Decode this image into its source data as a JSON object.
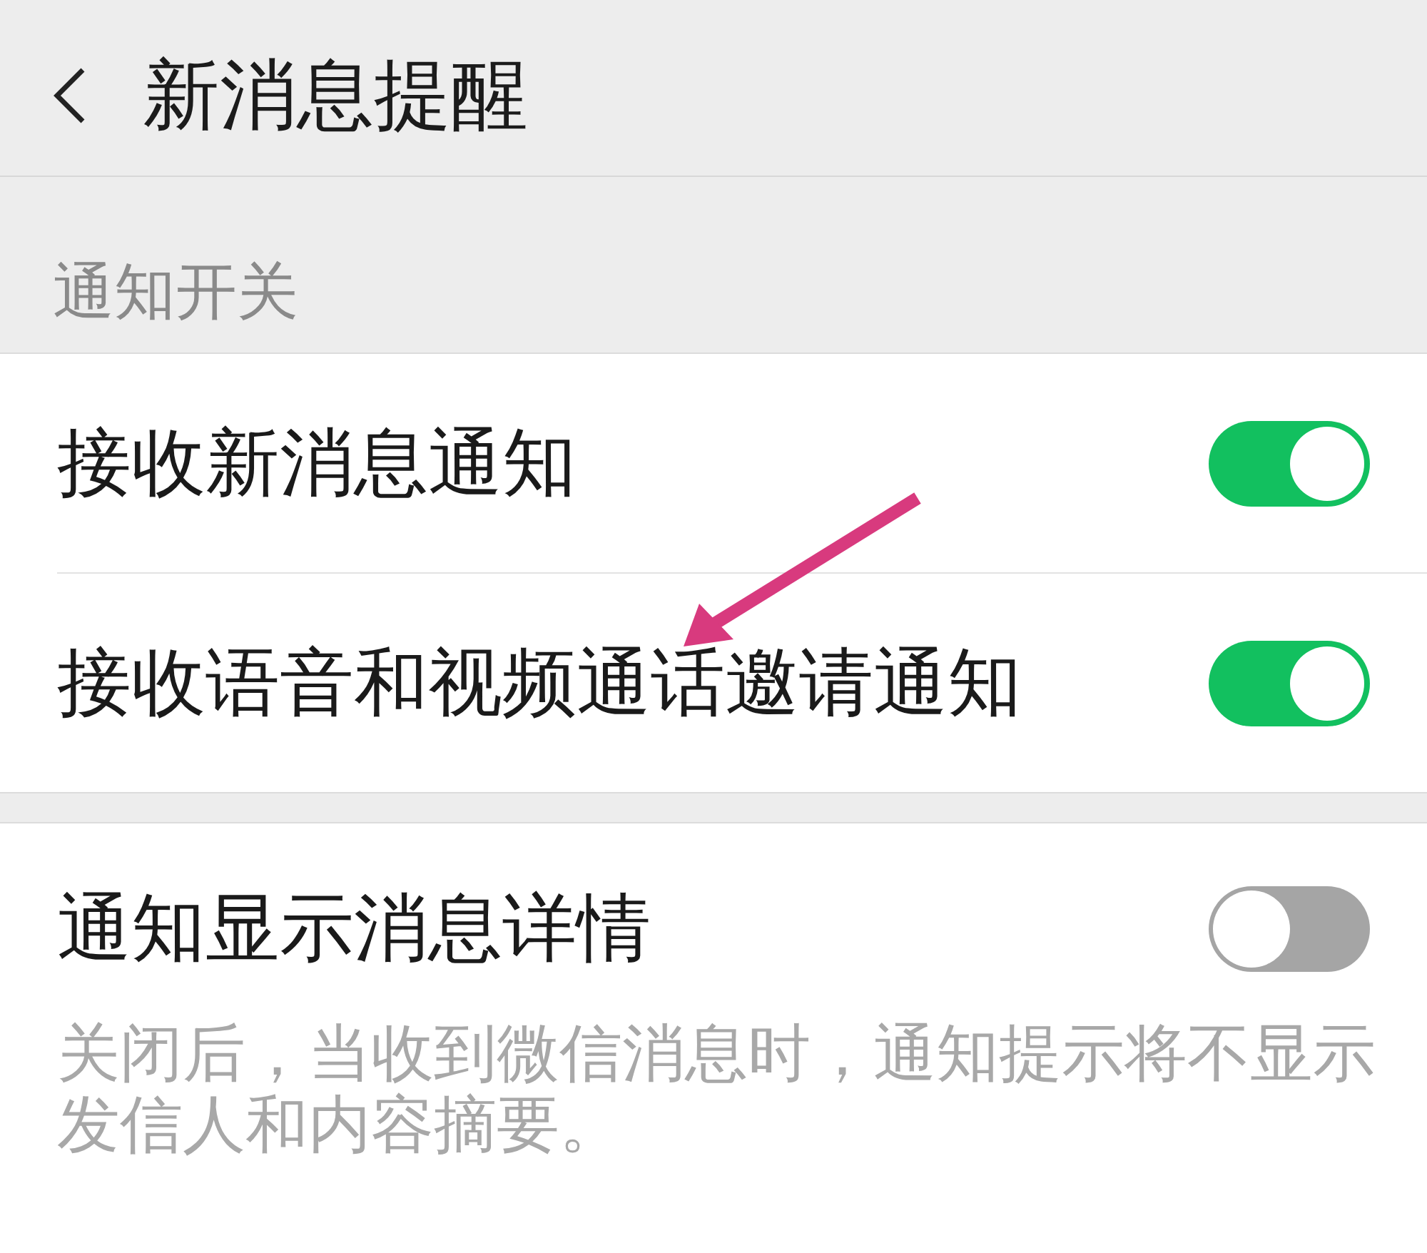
{
  "header": {
    "title": "新消息提醒"
  },
  "sections": [
    {
      "label": "通知开关",
      "rows": [
        {
          "label": "接收新消息通知",
          "on": true
        },
        {
          "label": "接收语音和视频通话邀请通知",
          "on": true
        }
      ]
    },
    {
      "rows": [
        {
          "label": "通知显示消息详情",
          "on": false,
          "description": "关闭后，当收到微信消息时，通知提示将不显示发信人和内容摘要。"
        }
      ]
    }
  ],
  "annotation": {
    "kind": "arrow"
  }
}
